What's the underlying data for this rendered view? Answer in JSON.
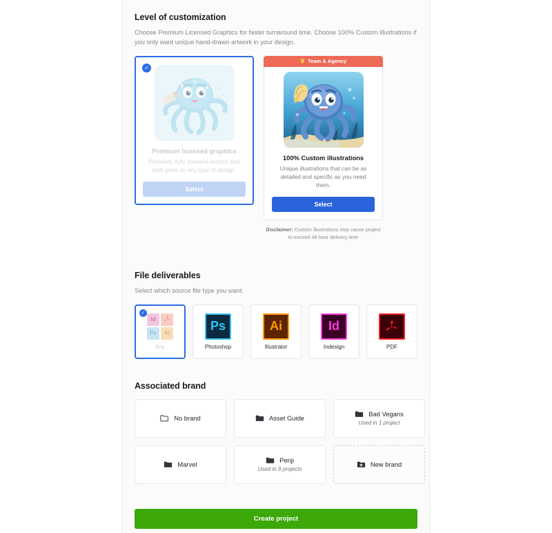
{
  "colors": {
    "accent_blue": "#2c6ce8",
    "primary_blue": "#2b63dd",
    "muted_blue": "#bfd4f5",
    "ribbon_coral": "#ee6a57",
    "crown_yellow": "#ffcf3f",
    "create_green": "#3ca80a",
    "panel_bg": "#fbfbfb"
  },
  "customization": {
    "title": "Level of customization",
    "subtitle": "Choose Premium Licensed Graphics for faster turnaround time. Choose 100% Custom Illustrations if you only want unique hand-drawn artwork in your design.",
    "options": [
      {
        "name": "Premium licensed graphics",
        "description": "Premium, fully licensed vectors that look great on any type of design.",
        "select_label": "Select",
        "selected": true,
        "ribbon": null,
        "illustration": "octopus-paintbrush-illustration"
      },
      {
        "name": "100% Custom illustrations",
        "description": "Unique illustrations that can be as detailed and specific as you need them.",
        "select_label": "Select",
        "selected": false,
        "ribbon": "Team & Agency",
        "ribbon_icon": "crown-icon",
        "illustration": "octopus-shell-underwater-illustration"
      }
    ],
    "disclaimer_label": "Disclaimer:",
    "disclaimer_text": " Custom illustrations may cause project to exceed 48 hour delivery time"
  },
  "file_deliverables": {
    "title": "File deliverables",
    "subtitle": "Select which source file type you want.",
    "options": [
      {
        "label": "Any",
        "icon": "any-files-icon",
        "selected": true
      },
      {
        "label": "Photoshop",
        "icon": "photoshop-icon",
        "abbr": "Ps",
        "selected": false
      },
      {
        "label": "Illustrator",
        "icon": "illustrator-icon",
        "abbr": "Ai",
        "selected": false
      },
      {
        "label": "Indesign",
        "icon": "indesign-icon",
        "abbr": "Id",
        "selected": false
      },
      {
        "label": "PDF",
        "icon": "pdf-acrobat-icon",
        "selected": false
      }
    ],
    "any_tiles": [
      "Id",
      "PDF",
      "Ps",
      "Ai"
    ]
  },
  "associated_brand": {
    "title": "Associated brand",
    "brands": [
      {
        "name": "No brand",
        "usage": "",
        "icon": "folder-outline-icon",
        "dashed": false
      },
      {
        "name": "Asset Guide",
        "usage": "",
        "icon": "folder-icon",
        "dashed": false
      },
      {
        "name": "Bad Vegans",
        "usage": "Used in 1 project",
        "icon": "folder-icon",
        "dashed": false
      },
      {
        "name": "Marvel",
        "usage": "",
        "icon": "folder-icon",
        "dashed": false
      },
      {
        "name": "Penji",
        "usage": "Used in 9 projects",
        "icon": "folder-icon",
        "dashed": false
      },
      {
        "name": "New brand",
        "usage": "",
        "icon": "folder-plus-icon",
        "dashed": true
      }
    ]
  },
  "footer": {
    "create_label": "Create project"
  }
}
